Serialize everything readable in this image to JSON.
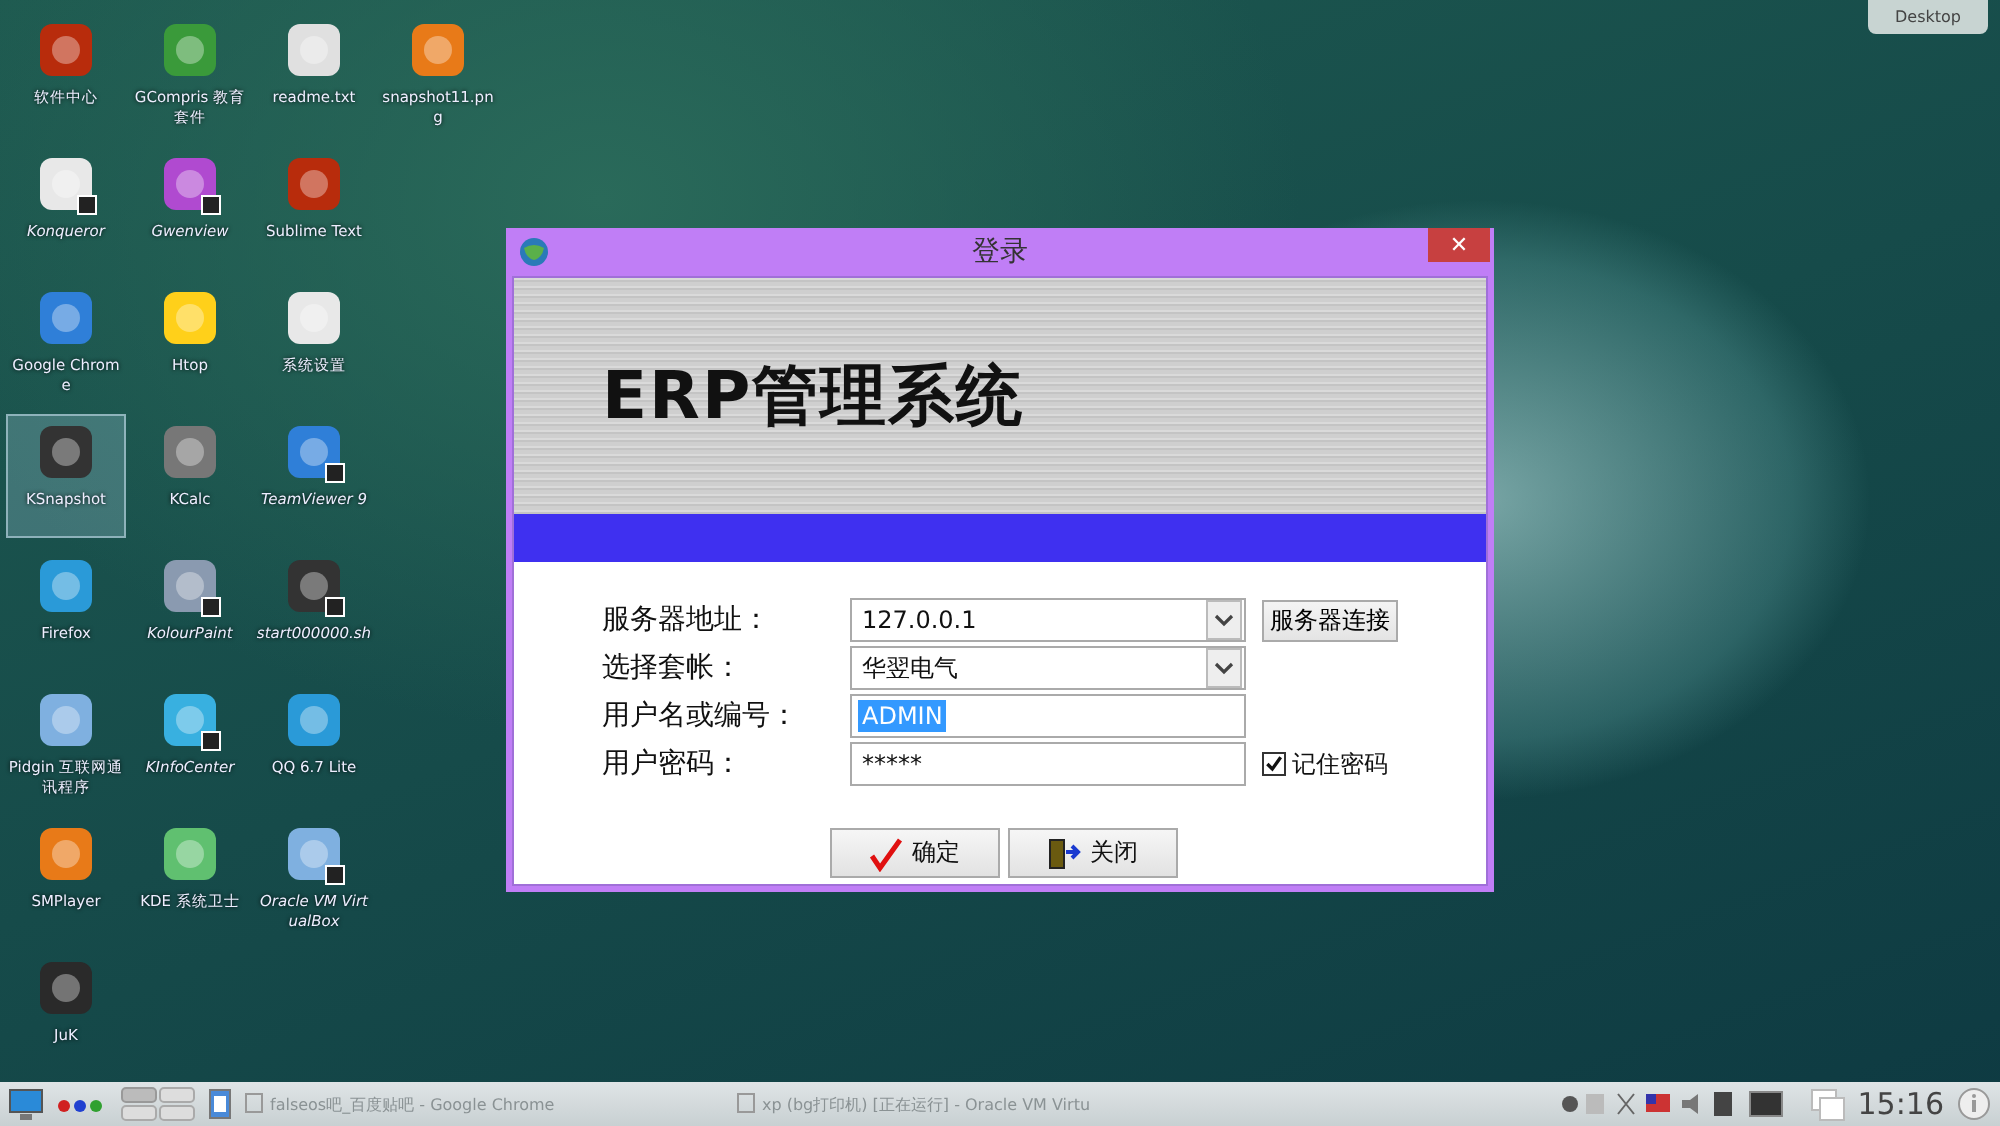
{
  "desktop_columns": [
    {
      "icons": [
        {
          "label": "软件中心",
          "shortcut": false,
          "selected": false
        },
        {
          "label": "Konqueror",
          "shortcut": true,
          "selected": false
        },
        {
          "label": "Google Chrome",
          "shortcut": false,
          "selected": false
        },
        {
          "label": "KSnapshot",
          "shortcut": false,
          "selected": true
        },
        {
          "label": "Firefox",
          "shortcut": false,
          "selected": false
        },
        {
          "label": "Pidgin 互联网通讯程序",
          "shortcut": false,
          "selected": false
        },
        {
          "label": "SMPlayer",
          "shortcut": false,
          "selected": false
        },
        {
          "label": "JuK",
          "shortcut": false,
          "selected": false
        }
      ]
    },
    {
      "icons": [
        {
          "label": "GCompris 教育套件",
          "shortcut": false,
          "selected": false
        },
        {
          "label": "Gwenview",
          "shortcut": true,
          "selected": false
        },
        {
          "label": "Htop",
          "shortcut": false,
          "selected": false
        },
        {
          "label": "KCalc",
          "shortcut": false,
          "selected": false
        },
        {
          "label": "KolourPaint",
          "shortcut": true,
          "selected": false
        },
        {
          "label": "KInfoCenter",
          "shortcut": true,
          "selected": false
        },
        {
          "label": "KDE 系统卫士",
          "shortcut": false,
          "selected": false
        }
      ]
    },
    {
      "icons": [
        {
          "label": "readme.txt",
          "shortcut": false,
          "selected": false
        },
        {
          "label": "Sublime Text",
          "shortcut": false,
          "selected": false
        },
        {
          "label": "系统设置",
          "shortcut": false,
          "selected": false
        },
        {
          "label": "TeamViewer 9",
          "shortcut": true,
          "selected": false
        },
        {
          "label": "start000000.sh",
          "shortcut": true,
          "selected": false
        },
        {
          "label": "QQ 6.7 Lite",
          "shortcut": false,
          "selected": false
        },
        {
          "label": "Oracle VM VirtualBox",
          "shortcut": true,
          "selected": false
        }
      ]
    },
    {
      "icons": [
        {
          "label": "snapshot11.png",
          "shortcut": false,
          "selected": false
        }
      ]
    }
  ],
  "desktop_button": {
    "label": "Desktop"
  },
  "dialog": {
    "title": "登录",
    "close": "✕",
    "banner_title": "ERP管理系统",
    "fields": [
      {
        "kind": "combo",
        "label": "服务器地址：",
        "value": "127.0.0.1",
        "value_selected": false
      },
      {
        "kind": "combo",
        "label": "选择套帐：",
        "value": "华翌电气",
        "value_selected": false
      },
      {
        "kind": "text",
        "label": "用户名或编号：",
        "value": "ADMIN",
        "value_selected": true
      },
      {
        "kind": "password",
        "label": "用户密码：",
        "value": "*****",
        "value_selected": false
      }
    ],
    "connect_button": "服务器连接",
    "remember": {
      "label": "记住密码",
      "checked": true
    },
    "buttons": [
      {
        "kind": "ok",
        "label": "确定"
      },
      {
        "kind": "close",
        "label": "关闭"
      }
    ]
  },
  "taskbar": {
    "tasks": [
      {
        "label": "falseos吧_百度贴吧 - Google Chrome"
      },
      {
        "label": "xp (bg打印机) [正在运行] - Oracle VM Virtu"
      }
    ],
    "clock": "15:16"
  }
}
